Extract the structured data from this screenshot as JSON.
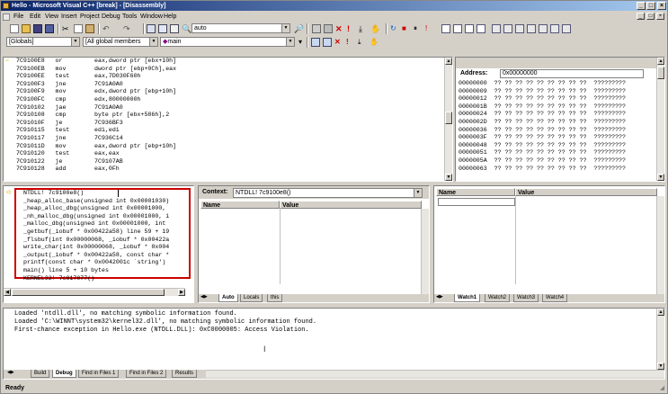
{
  "title": "Hello - Microsoft Visual C++ [break] - [Disassembly]",
  "menu": [
    "File",
    "Edit",
    "View",
    "Insert",
    "Project",
    "Debug",
    "Tools",
    "Window",
    "Help"
  ],
  "toolbar": {
    "config_combo": "auto",
    "scope_combo": "[Globals]",
    "members_combo": "[All global members",
    "function_combo": "main"
  },
  "disassembly": [
    {
      "addr": "7C9100E8",
      "op": "or",
      "args": "eax,dword ptr [ebx+10h]"
    },
    {
      "addr": "7C9100EB",
      "op": "mov",
      "args": "dword ptr [ebp+0Ch],eax"
    },
    {
      "addr": "7C9100EE",
      "op": "test",
      "args": "eax,7D030F60h"
    },
    {
      "addr": "7C9100F3",
      "op": "jne",
      "args": "7C91A0A0"
    },
    {
      "addr": "7C9100F9",
      "op": "mov",
      "args": "edx,dword ptr [ebp+10h]"
    },
    {
      "addr": "7C9100FC",
      "op": "cmp",
      "args": "edx,80000000h"
    },
    {
      "addr": "7C910102",
      "op": "jae",
      "args": "7C91A0A0"
    },
    {
      "addr": "7C910108",
      "op": "cmp",
      "args": "byte ptr [ebx+586h],2"
    },
    {
      "addr": "7C91010F",
      "op": "je",
      "args": "7C936BF3"
    },
    {
      "addr": "7C910115",
      "op": "test",
      "args": "edi,edi"
    },
    {
      "addr": "7C910117",
      "op": "jne",
      "args": "7C936C14"
    },
    {
      "addr": "7C91011D",
      "op": "mov",
      "args": "eax,dword ptr [ebp+10h]"
    },
    {
      "addr": "7C910120",
      "op": "test",
      "args": "eax,eax"
    },
    {
      "addr": "7C910122",
      "op": "je",
      "args": "7C9107AB"
    },
    {
      "addr": "7C910128",
      "op": "add",
      "args": "eax,0Fh"
    }
  ],
  "memory": {
    "address_label": "Address:",
    "address_value": "0x00000000",
    "rows": [
      {
        "addr": "00000000",
        "bytes": "?? ?? ?? ?? ?? ?? ?? ?? ??",
        "chars": "?????????"
      },
      {
        "addr": "00000009",
        "bytes": "?? ?? ?? ?? ?? ?? ?? ?? ??",
        "chars": "?????????"
      },
      {
        "addr": "00000012",
        "bytes": "?? ?? ?? ?? ?? ?? ?? ?? ??",
        "chars": "?????????"
      },
      {
        "addr": "0000001B",
        "bytes": "?? ?? ?? ?? ?? ?? ?? ?? ??",
        "chars": "?????????"
      },
      {
        "addr": "00000024",
        "bytes": "?? ?? ?? ?? ?? ?? ?? ?? ??",
        "chars": "?????????"
      },
      {
        "addr": "0000002D",
        "bytes": "?? ?? ?? ?? ?? ?? ?? ?? ??",
        "chars": "?????????"
      },
      {
        "addr": "00000036",
        "bytes": "?? ?? ?? ?? ?? ?? ?? ?? ??",
        "chars": "?????????"
      },
      {
        "addr": "0000003F",
        "bytes": "?? ?? ?? ?? ?? ?? ?? ?? ??",
        "chars": "?????????"
      },
      {
        "addr": "00000048",
        "bytes": "?? ?? ?? ?? ?? ?? ?? ?? ??",
        "chars": "?????????"
      },
      {
        "addr": "00000051",
        "bytes": "?? ?? ?? ?? ?? ?? ?? ?? ??",
        "chars": "?????????"
      },
      {
        "addr": "0000005A",
        "bytes": "?? ?? ?? ?? ?? ?? ?? ?? ??",
        "chars": "?????????"
      },
      {
        "addr": "00000063",
        "bytes": "?? ?? ?? ?? ?? ?? ?? ?? ??",
        "chars": "?????????"
      }
    ]
  },
  "callstack": [
    "NTDLL! 7c9100e8()",
    "_heap_alloc_base(unsigned int 0x00001030)",
    "_heap_alloc_dbg(unsigned int 0x00001000,",
    "_nh_malloc_dbg(unsigned int 0x00001000, i",
    "_malloc_dbg(unsigned int 0x00001000, int",
    "_getbuf(_iobuf * 0x00422a58) line 59 + 19",
    "_flsbuf(int 0x00000068, _iobuf * 0x00422a",
    "write_char(int 0x00000068, _iobuf * 0x004",
    "_output(_iobuf * 0x00422a58, const char *",
    "printf(const char * 0x0042001c `string')",
    "main() line 5 + 10 bytes",
    "KERNEL32! 7c817077()"
  ],
  "variables": {
    "context_label": "Context:",
    "context_value": "NTDLL! 7c9100e8()",
    "col_name": "Name",
    "col_value": "Value",
    "tabs": [
      "Auto",
      "Locals",
      "this"
    ]
  },
  "watch": {
    "col_name": "Name",
    "col_value": "Value",
    "tabs": [
      "Watch1",
      "Watch2",
      "Watch3",
      "Watch4"
    ]
  },
  "output": {
    "lines": [
      "Loaded 'ntdll.dll', no matching symbolic information found.",
      "Loaded 'C:\\WINNT\\system32\\kernel32.dll', no matching symbolic information found.",
      "First-chance exception in Hello.exe (NTDLL.DLL): 0xC0000005: Access Violation."
    ],
    "tabs": [
      "Build",
      "Debug",
      "Find in Files 1",
      "Find in Files 2",
      "Results"
    ]
  },
  "status": "Ready",
  "colors": {
    "title_start": "#0a246a",
    "title_end": "#a6caf0",
    "highlight_border": "#cc0000",
    "arrow": "#f0d000"
  }
}
